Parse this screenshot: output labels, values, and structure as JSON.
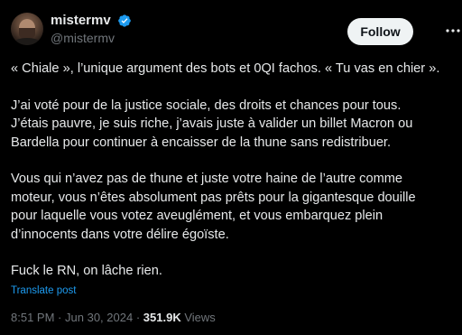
{
  "author": {
    "display_name": "mistermv",
    "handle": "@mistermv",
    "verified": true,
    "avatar_icon": "avatar-photo"
  },
  "actions": {
    "follow_label": "Follow",
    "more_icon": "more-horizontal-icon"
  },
  "tweet": {
    "paragraphs": [
      [
        "« Chiale », l’unique argument des bots et 0QI fachos. « Tu vas en chier »."
      ],
      [
        "J’ai voté pour de la justice sociale, des droits et chances pour tous.",
        "J’étais pauvre, je suis riche, j’avais juste à valider un billet Macron ou",
        "Bardella pour continuer à encaisser de la thune sans redistribuer."
      ],
      [
        "Vous qui n’avez pas de thune et juste votre haine de l’autre comme",
        "moteur, vous n’êtes absolument pas prêts pour la gigantesque douille",
        "pour laquelle vous votez aveuglément, et vous embarquez plein",
        "d’innocents dans votre délire égoïste."
      ],
      [
        "Fuck le RN, on lâche rien."
      ]
    ],
    "translate_label": "Translate post"
  },
  "meta": {
    "time": "8:51 PM",
    "separator": "·",
    "date": "Jun 30, 2024",
    "views_count": "351.9K",
    "views_label": "Views"
  },
  "colors": {
    "background": "#000000",
    "text_primary": "#e7e9ea",
    "text_secondary": "#71767b",
    "accent": "#1d9bf0",
    "follow_bg": "#eff3f4"
  }
}
